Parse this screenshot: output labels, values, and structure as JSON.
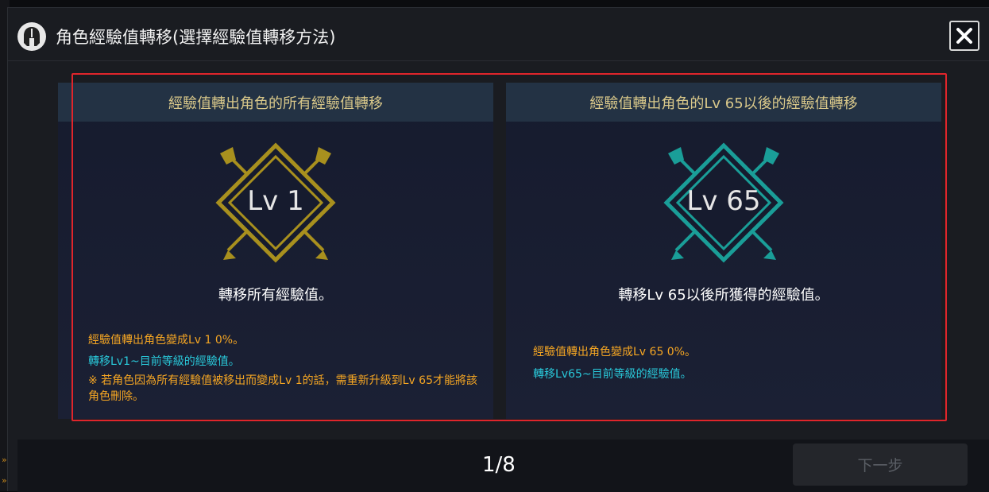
{
  "dialog": {
    "title": "角色經驗值轉移(選擇經驗值轉移方法)",
    "close_icon": "close-icon"
  },
  "options": [
    {
      "header": "經驗值轉出角色的所有經驗值轉移",
      "badge_label": "Lv 1",
      "badge_color": "#a8901e",
      "description": "轉移所有經驗值。",
      "line1": "經驗值轉出角色變成Lv 1 0%。",
      "line2": "轉移Lv1~目前等級的經驗值。",
      "note": "※ 若角色因為所有經驗值被移出而變成Lv 1的話，需重新升級到Lv 65才能將該角色刪除。"
    },
    {
      "header": "經驗值轉出角色的Lv 65以後的經驗值轉移",
      "badge_label": "Lv 65",
      "badge_color": "#1a9e98",
      "description": "轉移Lv 65以後所獲得的經驗值。",
      "line1": "經驗值轉出角色變成Lv 65 0%。",
      "line2": "轉移Lv65~目前等級的經驗值。"
    }
  ],
  "footer": {
    "page": "1/8",
    "next_label": "下一步"
  },
  "colors": {
    "selection": "#e0252b",
    "orange_text": "#f5a623",
    "cyan_text": "#29c8d9"
  }
}
